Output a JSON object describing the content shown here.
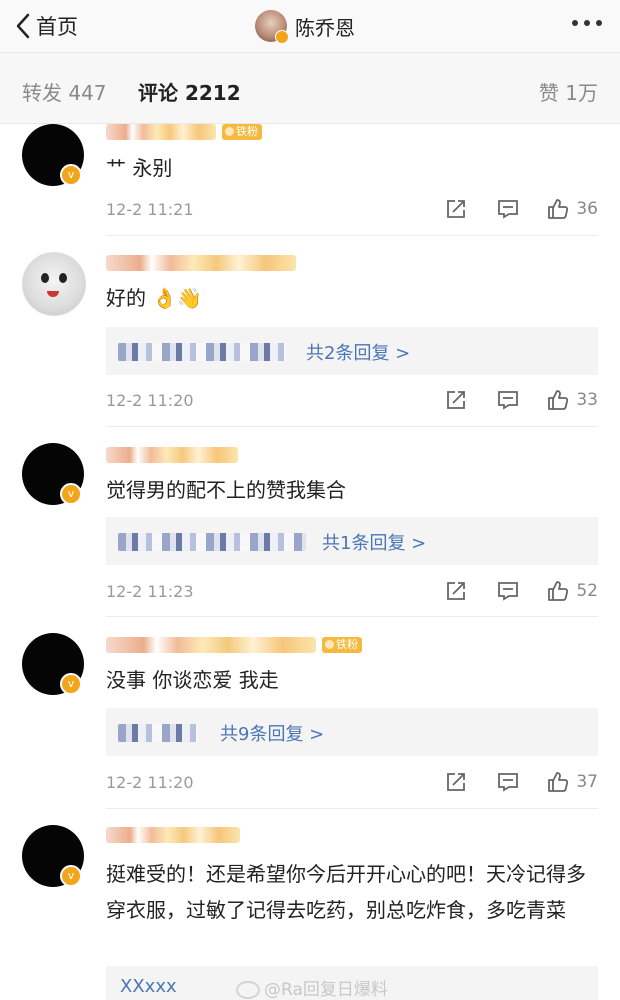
{
  "header": {
    "back_label": "首页",
    "title": "陈乔恩"
  },
  "tabs": {
    "forward": "转发 447",
    "comments": "评论 2212",
    "likes": "赞 1万"
  },
  "fan_badge": "铁粉",
  "comments": [
    {
      "text": "艹 永别",
      "time": "12-2 11:21",
      "likes": "36",
      "reply_more": ""
    },
    {
      "text": "好的",
      "emoji": "👌👋",
      "time": "12-2 11:20",
      "likes": "33",
      "reply_more": "共2条回复 >"
    },
    {
      "text": "觉得男的配不上的赞我集合",
      "time": "12-2 11:23",
      "likes": "52",
      "reply_more": "共1条回复 >"
    },
    {
      "text": "没事 你谈恋爱 我走",
      "time": "12-2 11:20",
      "likes": "37",
      "reply_more": "共9条回复 >"
    },
    {
      "text": "挺难受的！还是希望你今后开开心心的吧！天冷记得多穿衣服，过敏了记得去吃药，别总吃炸食，多吃青菜",
      "reply_partial": "XXxxx",
      "time": "",
      "likes": ""
    }
  ],
  "watermark": "@Ra回复日爆料",
  "icons": {
    "back": "chevron-left-icon",
    "more": "more-dots-icon",
    "share": "share-icon",
    "reply": "comment-icon",
    "like": "thumbs-up-icon",
    "verified": "verified-badge-icon"
  },
  "colors": {
    "accent_link": "#4b76b6",
    "badge": "#f2a51a",
    "meta_text": "#9a9a9a"
  }
}
